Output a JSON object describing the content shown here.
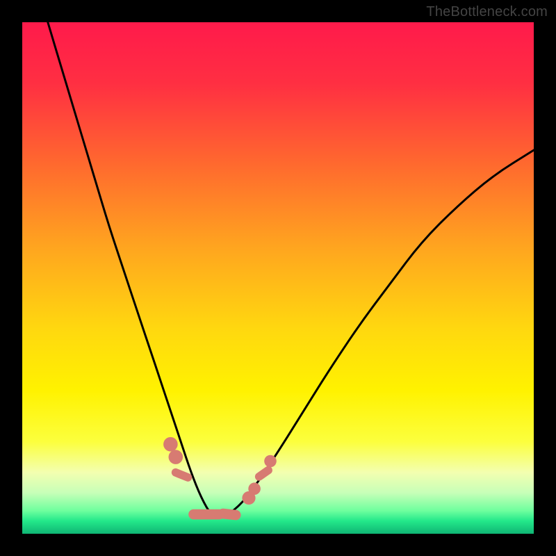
{
  "watermark": "TheBottleneck.com",
  "chart_data": {
    "type": "line",
    "title": "",
    "xlabel": "",
    "ylabel": "",
    "xlim": [
      0,
      100
    ],
    "ylim": [
      0,
      100
    ],
    "grid": false,
    "background_gradient": {
      "stops": [
        {
          "offset": 0.0,
          "color": "#ff1a4b"
        },
        {
          "offset": 0.12,
          "color": "#ff2f42"
        },
        {
          "offset": 0.28,
          "color": "#ff6a2e"
        },
        {
          "offset": 0.44,
          "color": "#ffa51f"
        },
        {
          "offset": 0.6,
          "color": "#ffd80f"
        },
        {
          "offset": 0.72,
          "color": "#fff200"
        },
        {
          "offset": 0.82,
          "color": "#fcff3d"
        },
        {
          "offset": 0.88,
          "color": "#f3ffb0"
        },
        {
          "offset": 0.92,
          "color": "#c7ffb8"
        },
        {
          "offset": 0.955,
          "color": "#6eff9e"
        },
        {
          "offset": 0.975,
          "color": "#23e88a"
        },
        {
          "offset": 1.0,
          "color": "#0fb574"
        }
      ]
    },
    "series": [
      {
        "name": "curve",
        "description": "V-shaped bottleneck curve; single minimum near x≈37 where it touches the green band.",
        "color": "#000000",
        "x": [
          5,
          8,
          11,
          14,
          17,
          20,
          23,
          25,
          27,
          29,
          31,
          33,
          35,
          37,
          40,
          43,
          46,
          50,
          55,
          60,
          66,
          72,
          78,
          85,
          92,
          100
        ],
        "y": [
          100,
          90,
          80,
          70,
          60,
          51,
          42,
          36,
          30,
          24,
          18,
          12,
          7,
          3.5,
          3.5,
          6,
          10,
          16,
          24,
          32,
          41,
          49,
          57,
          64,
          70,
          75
        ]
      }
    ],
    "markers": {
      "color": "#d77b72",
      "description": "Rounded ‘lozenge’ markers clustered near the curve bottom",
      "points": [
        {
          "x": 29.0,
          "y": 17.5,
          "shape": "round",
          "r": 1.4
        },
        {
          "x": 30.0,
          "y": 15.0,
          "shape": "round",
          "r": 1.4
        },
        {
          "x": 31.2,
          "y": 11.5,
          "shape": "pill",
          "w": 1.6,
          "h": 4.2,
          "angle": -68
        },
        {
          "x": 36.0,
          "y": 3.8,
          "shape": "pill",
          "w": 7.0,
          "h": 2.0,
          "angle": 0
        },
        {
          "x": 40.5,
          "y": 3.8,
          "shape": "pill",
          "w": 4.5,
          "h": 2.0,
          "angle": 6
        },
        {
          "x": 44.3,
          "y": 7.0,
          "shape": "round",
          "r": 1.3
        },
        {
          "x": 45.4,
          "y": 8.8,
          "shape": "round",
          "r": 1.2
        },
        {
          "x": 47.2,
          "y": 11.8,
          "shape": "pill",
          "w": 1.6,
          "h": 3.8,
          "angle": 55
        },
        {
          "x": 48.5,
          "y": 14.2,
          "shape": "round",
          "r": 1.2
        }
      ]
    }
  }
}
